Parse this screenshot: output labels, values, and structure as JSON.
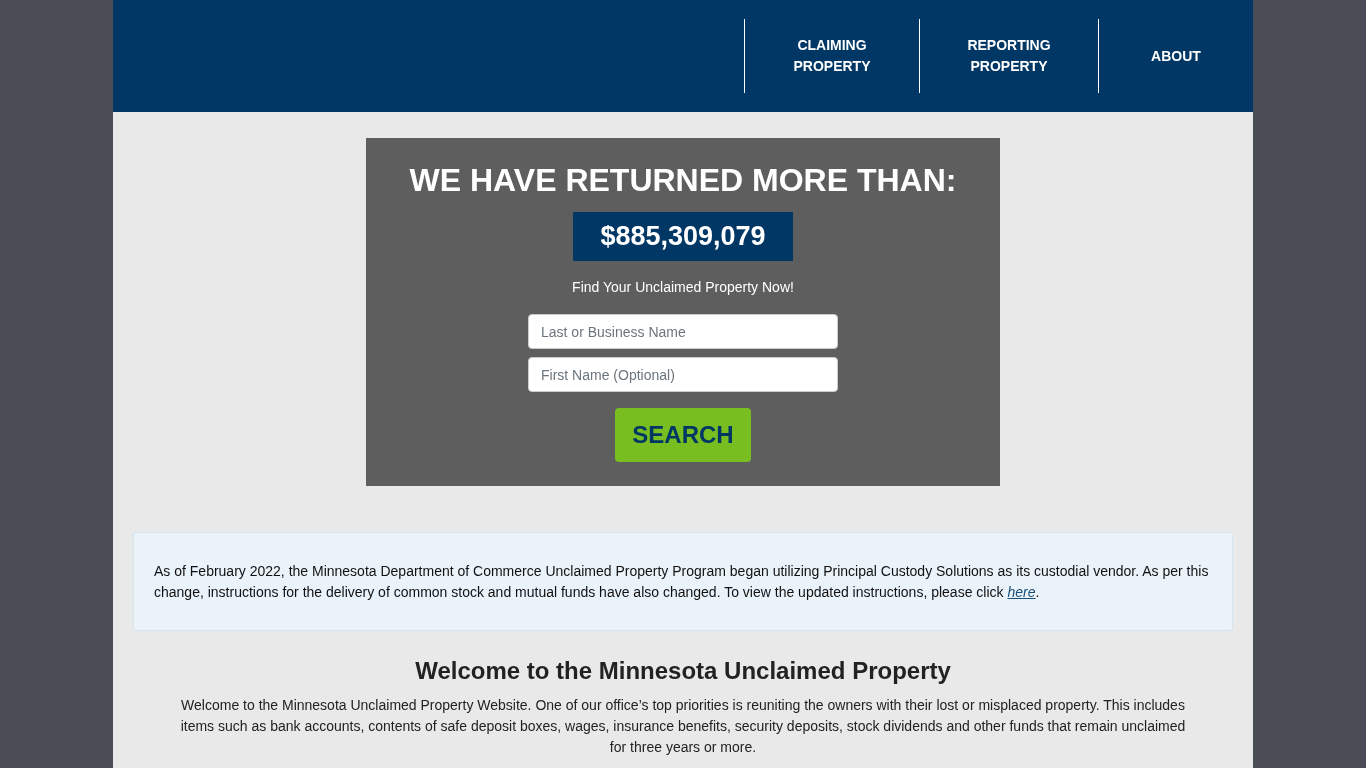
{
  "nav": {
    "items": [
      {
        "label": "CLAIMING PROPERTY"
      },
      {
        "label": "REPORTING PROPERTY"
      },
      {
        "label": "ABOUT"
      }
    ]
  },
  "hero": {
    "title": "WE HAVE RETURNED MORE THAN:",
    "amount": "$885,309,079",
    "subtitle": "Find Your Unclaimed Property Now!",
    "fields": [
      {
        "placeholder": "Last or Business Name"
      },
      {
        "placeholder": "First Name (Optional)"
      }
    ],
    "button": "SEARCH"
  },
  "notice": {
    "text": "As of February 2022, the Minnesota Department of Commerce Unclaimed Property Program began utilizing Principal Custody Solutions as its custodial vendor. As per this change, instructions for the delivery of common stock and mutual funds have also changed. To view the updated instructions, please click",
    "link": "here",
    "after": "."
  },
  "welcome": {
    "heading": "Welcome to the Minnesota Unclaimed Property",
    "text": "Welcome to the Minnesota Unclaimed Property Website. One of our office’s top priorities is reuniting the owners with their lost or misplaced property. This includes items such as bank accounts, contents of safe deposit boxes, wages, insurance benefits, security deposits, stock dividends and other funds that remain unclaimed for three years or more."
  }
}
